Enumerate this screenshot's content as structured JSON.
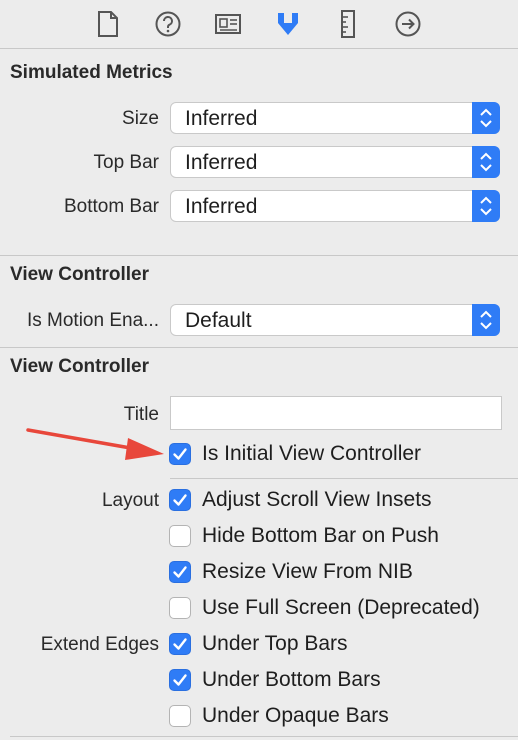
{
  "toolbar": {
    "icons": [
      "file-inspector-icon",
      "quick-help-icon",
      "identity-inspector-icon",
      "attributes-inspector-icon",
      "size-inspector-icon",
      "connections-inspector-icon"
    ],
    "selected": "attributes-inspector-icon",
    "accent": "#2f7cf6"
  },
  "simulated_metrics": {
    "title": "Simulated Metrics",
    "size": {
      "label": "Size",
      "value": "Inferred"
    },
    "top_bar": {
      "label": "Top Bar",
      "value": "Inferred"
    },
    "bottom_bar": {
      "label": "Bottom Bar",
      "value": "Inferred"
    }
  },
  "view_controller_1": {
    "title": "View Controller",
    "motion": {
      "label": "Is Motion Ena...",
      "value": "Default"
    }
  },
  "view_controller_2": {
    "title": "View Controller",
    "title_field": {
      "label": "Title",
      "value": ""
    },
    "initial": {
      "label": "Is Initial View Controller",
      "checked": true
    },
    "layout_label": "Layout",
    "layout": [
      {
        "label": "Adjust Scroll View Insets",
        "checked": true
      },
      {
        "label": "Hide Bottom Bar on Push",
        "checked": false
      },
      {
        "label": "Resize View From NIB",
        "checked": true
      },
      {
        "label": "Use Full Screen (Deprecated)",
        "checked": false
      }
    ],
    "extend_label": "Extend Edges",
    "extend": [
      {
        "label": "Under Top Bars",
        "checked": true
      },
      {
        "label": "Under Bottom Bars",
        "checked": true
      },
      {
        "label": "Under Opaque Bars",
        "checked": false
      }
    ]
  },
  "annotation": {
    "arrow_color": "#e8473b"
  }
}
